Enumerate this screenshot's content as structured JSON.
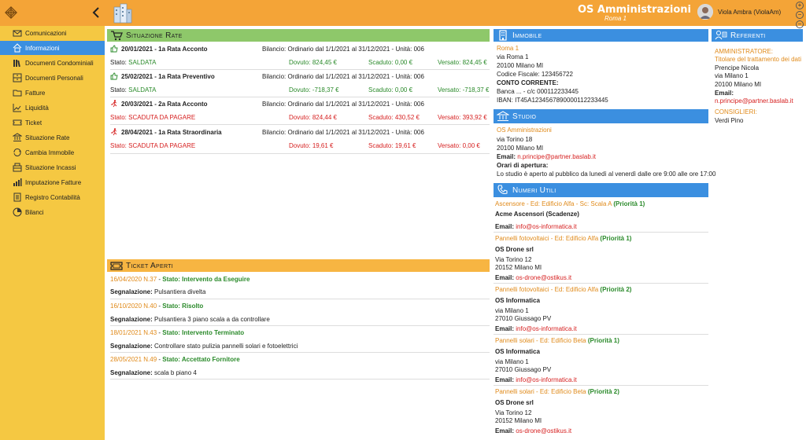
{
  "header": {
    "title": "OS Amministrazioni",
    "subtitle": "Roma 1",
    "user": "Viola Ambra (ViolaAm)",
    "controls": [
      "+",
      "−",
      "−"
    ]
  },
  "sidebar": {
    "items": [
      {
        "label": "Comunicazioni",
        "icon": "envelope-icon"
      },
      {
        "label": "Informazioni",
        "icon": "home-icon",
        "active": true
      },
      {
        "label": "Documenti Condominiali",
        "icon": "library-icon"
      },
      {
        "label": "Documenti Personali",
        "icon": "archive-icon"
      },
      {
        "label": "Fatture",
        "icon": "folder-icon"
      },
      {
        "label": "Liquidità",
        "icon": "chart-icon"
      },
      {
        "label": "Ticket",
        "icon": "ticket-icon"
      },
      {
        "label": "Situazione Rate",
        "icon": "bank-icon"
      },
      {
        "label": "Cambia Immobile",
        "icon": "sync-icon"
      },
      {
        "label": "Situazione Incassi",
        "icon": "cashbox-icon"
      },
      {
        "label": "Imputazione Fatture",
        "icon": "bars-icon"
      },
      {
        "label": "Registro Contabilità",
        "icon": "register-icon"
      },
      {
        "label": "Bilanci",
        "icon": "pie-icon"
      }
    ]
  },
  "rate": {
    "title": "Situazione Rate",
    "rows": [
      {
        "date": "20/01/2021 - 1a Rata Acconto",
        "bilancio": "Bilancio: Ordinario dal 1/1/2021 al 31/12/2021 - Unità: 006",
        "stato": "SALDATA",
        "dovuto": "824,45 €",
        "scaduto": "0,00 €",
        "versato": "824,45 €",
        "ok": true
      },
      {
        "date": "25/02/2021 - 1a Rata Preventivo",
        "bilancio": "Bilancio: Ordinario dal 1/1/2021 al 31/12/2021 - Unità: 006",
        "stato": "SALDATA",
        "dovuto": "-718,37 €",
        "scaduto": "0,00 €",
        "versato": "-718,37 €",
        "ok": true
      },
      {
        "date": "20/03/2021 - 2a Rata Acconto",
        "bilancio": "Bilancio: Ordinario dal 1/1/2021 al 31/12/2021 - Unità: 006",
        "stato": "SCADUTA DA PAGARE",
        "dovuto": "824,44 €",
        "scaduto": "430,52 €",
        "versato": "393,92 €",
        "ok": false
      },
      {
        "date": "28/04/2021 - 1a Rata Straordinaria",
        "bilancio": "Bilancio: Ordinario dal 1/1/2021 al 31/12/2021 - Unità: 006",
        "stato": "SCADUTA DA PAGARE",
        "dovuto": "19,61 €",
        "scaduto": "19,61 €",
        "versato": "0,00 €",
        "ok": false
      }
    ],
    "labels": {
      "stato": "Stato:",
      "dovuto": "Dovuto:",
      "scaduto": "Scaduto:",
      "versato": "Versato:"
    }
  },
  "ticket": {
    "title": "Ticket Aperti",
    "rows": [
      {
        "num": "16/04/2020 N.37",
        "stato": "Stato: Intervento da Eseguire",
        "segn": "Pulsantiera divelta"
      },
      {
        "num": "16/10/2020 N.40",
        "stato": "Stato: Risolto",
        "segn": "Pulsantiera 3 piano scala a da controllare"
      },
      {
        "num": "18/01/2021 N.43",
        "stato": "Stato: Intervento Terminato",
        "segn": "Controllare stato pulizia pannelli solari e fotoelettrici"
      },
      {
        "num": "28/05/2021 N.49",
        "stato": "Stato: Accettato Fornitore",
        "segn": "scala b piano 4"
      }
    ],
    "segn_label": "Segnalazione:"
  },
  "immobile": {
    "title": "Immobile",
    "name": "Roma 1",
    "address": "via Roma 1",
    "city": "20100 Milano MI",
    "cf": "Codice Fiscale: 123456722",
    "cc_label": "CONTO CORRENTE:",
    "banca": "Banca ... - c/c 000112233445",
    "iban": "IBAN: IT45A1234567890000112233445"
  },
  "studio": {
    "title": "Studio",
    "name": "OS Amministrazioni",
    "address": "via Torino 18",
    "city": "20100 Milano MI",
    "email_label": "Email:",
    "email": "n.principe@partner.baslab.it",
    "orari_label": "Orari di apertura:",
    "orari": "Lo studio è aperto al pubblico da lunedì al venerdì dalle ore 9:00 alle ore 17:00"
  },
  "referenti": {
    "title": "Referenti",
    "amm_label": "AMMINISTRATORE:",
    "amm_role": "Titolare del trattamento dei dati",
    "amm_name": "Prencipe Nicola",
    "amm_addr": "via Milano 1",
    "amm_city": "20100 Milano MI",
    "email_label": "Email:",
    "amm_email": "n.principe@partner.baslab.it",
    "cons_label": "CONSIGLIERI:",
    "cons_name": "Verdi Pino"
  },
  "numeri": {
    "title": "Numeri Utili",
    "email_label": "Email:",
    "entries": [
      {
        "head": "Ascensore - Ed: Edificio Alfa - Sc: Scala A",
        "prio": "(Priorità 1)",
        "company": "Acme Ascensori (Scadenze)",
        "addr1": "",
        "addr2": "",
        "email": "info@os-informatica.it"
      },
      {
        "head": "Pannelli fotovoltaici - Ed: Edificio Alfa",
        "prio": "(Priorità 1)",
        "company": "OS Drone srl",
        "addr1": "Via Torino 12",
        "addr2": "20152 Milano MI",
        "email": "os-drone@ostikus.it"
      },
      {
        "head": "Pannelli fotovoltaici - Ed: Edificio Alfa",
        "prio": "(Priorità 2)",
        "company": "OS Informatica",
        "addr1": "via Milano 1",
        "addr2": "27010 Giussago PV",
        "email": "info@os-informatica.it"
      },
      {
        "head": "Pannelli solari - Ed: Edificio Beta",
        "prio": "(Priorità 1)",
        "company": "OS Informatica",
        "addr1": "via Milano 1",
        "addr2": "27010 Giussago PV",
        "email": "info@os-informatica.it"
      },
      {
        "head": "Pannelli solari - Ed: Edificio Beta",
        "prio": "(Priorità 2)",
        "company": "OS Drone srl",
        "addr1": "Via Torino 12",
        "addr2": "20152 Milano MI",
        "email": "os-drone@ostikus.it"
      }
    ]
  },
  "colors": {
    "header": "#f4a437",
    "sidebar": "#f5c842",
    "active": "#3b8fe0",
    "green": "#8ec86a",
    "orange": "#f7b542"
  }
}
